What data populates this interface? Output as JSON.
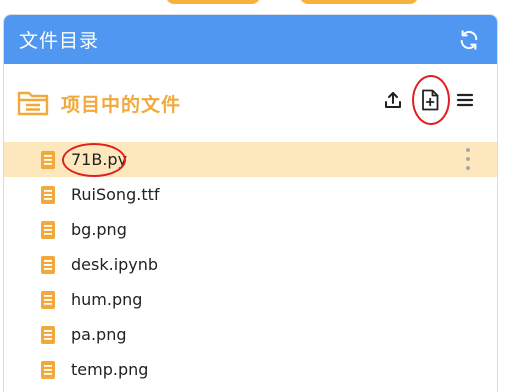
{
  "panel": {
    "title": "文件目录",
    "refresh_icon": "refresh-icon"
  },
  "toolbar": {
    "folder_icon": "folder-icon",
    "folder_title": "项目中的文件",
    "upload_icon": "upload-icon",
    "new_file_icon": "new-file-icon",
    "menu_icon": "menu-icon"
  },
  "colors": {
    "header_bg": "#4f97f0",
    "accent_orange": "#f2a93b",
    "selected_row_bg": "#fde8bd",
    "annotation_red": "#e02020"
  },
  "files": [
    {
      "name": "71B.py",
      "selected": true
    },
    {
      "name": "RuiSong.ttf",
      "selected": false
    },
    {
      "name": "bg.png",
      "selected": false
    },
    {
      "name": "desk.ipynb",
      "selected": false
    },
    {
      "name": "hum.png",
      "selected": false
    },
    {
      "name": "pa.png",
      "selected": false
    },
    {
      "name": "temp.png",
      "selected": false
    }
  ]
}
